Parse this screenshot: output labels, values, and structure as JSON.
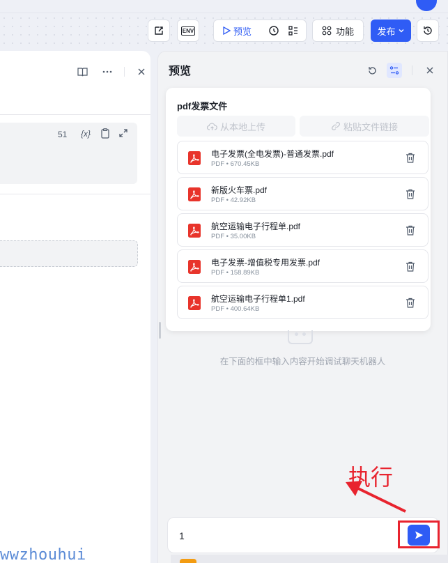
{
  "toolbar": {
    "preview_label": "预览",
    "features_label": "功能",
    "publish_label": "发布",
    "env_label": "ENV"
  },
  "left_panel": {
    "line_count": "51",
    "variable_label": "{x}"
  },
  "preview_panel": {
    "title": "预览",
    "file_section_title": "pdf发票文件",
    "upload_local_label": "从本地上传",
    "paste_link_label": "粘贴文件链接",
    "files": [
      {
        "name": "电子发票(全电发票)-普通发票.pdf",
        "meta": "PDF • 670.45KB"
      },
      {
        "name": "新版火车票.pdf",
        "meta": "PDF • 42.92KB"
      },
      {
        "name": "航空运输电子行程单.pdf",
        "meta": "PDF • 35.00KB"
      },
      {
        "name": "电子发票-增值税专用发票.pdf",
        "meta": "PDF • 158.89KB"
      },
      {
        "name": "航空运输电子行程单1.pdf",
        "meta": "PDF • 400.64KB"
      }
    ],
    "empty_hint": "在下面的框中输入内容开始调试聊天机器人",
    "chat_input_value": "1"
  },
  "annotation": {
    "label": "执行",
    "color": "#e8232e"
  },
  "watermark": "wwzhouhui",
  "colors": {
    "accent": "#2f5cf5",
    "pdf_red": "#e8342b"
  }
}
